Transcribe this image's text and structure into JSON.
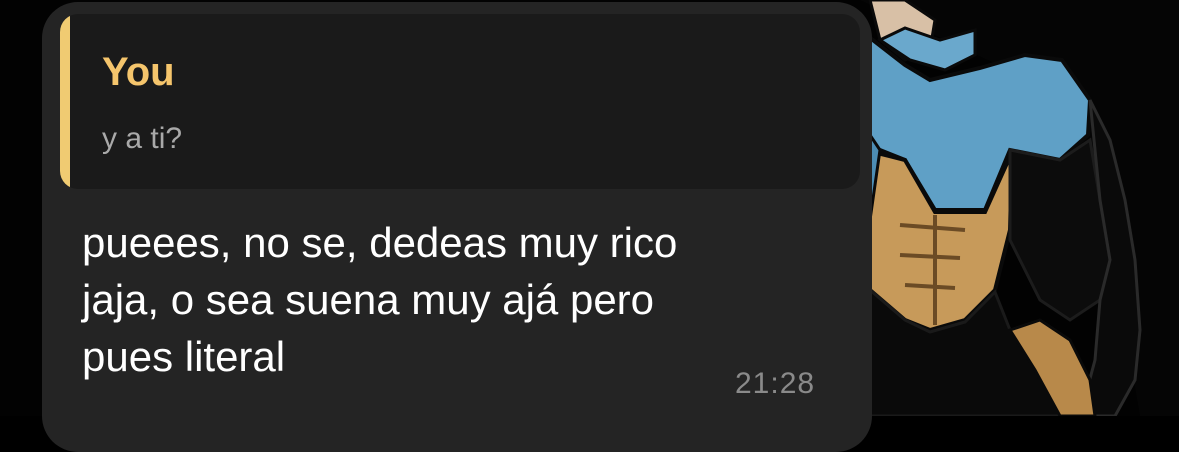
{
  "message": {
    "reply_preview": {
      "author": "You",
      "text": "y a ti?"
    },
    "text": "pueees, no se, dedeas muy rico\njaja, o sea suena muy ajá pero\npues literal",
    "time": "21:28"
  },
  "colors": {
    "bubble": "#242424",
    "reply_background": "#1a1a1a",
    "reply_accent": "#f0cb72",
    "reply_author": "#f5c56c",
    "wallpaper_background": "#000000"
  }
}
